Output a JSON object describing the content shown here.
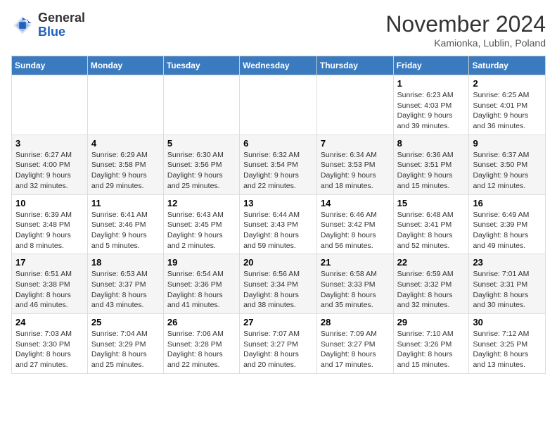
{
  "logo": {
    "general": "General",
    "blue": "Blue"
  },
  "header": {
    "month": "November 2024",
    "location": "Kamionka, Lublin, Poland"
  },
  "weekdays": [
    "Sunday",
    "Monday",
    "Tuesday",
    "Wednesday",
    "Thursday",
    "Friday",
    "Saturday"
  ],
  "weeks": [
    [
      {
        "day": "",
        "info": ""
      },
      {
        "day": "",
        "info": ""
      },
      {
        "day": "",
        "info": ""
      },
      {
        "day": "",
        "info": ""
      },
      {
        "day": "",
        "info": ""
      },
      {
        "day": "1",
        "info": "Sunrise: 6:23 AM\nSunset: 4:03 PM\nDaylight: 9 hours and 39 minutes."
      },
      {
        "day": "2",
        "info": "Sunrise: 6:25 AM\nSunset: 4:01 PM\nDaylight: 9 hours and 36 minutes."
      }
    ],
    [
      {
        "day": "3",
        "info": "Sunrise: 6:27 AM\nSunset: 4:00 PM\nDaylight: 9 hours and 32 minutes."
      },
      {
        "day": "4",
        "info": "Sunrise: 6:29 AM\nSunset: 3:58 PM\nDaylight: 9 hours and 29 minutes."
      },
      {
        "day": "5",
        "info": "Sunrise: 6:30 AM\nSunset: 3:56 PM\nDaylight: 9 hours and 25 minutes."
      },
      {
        "day": "6",
        "info": "Sunrise: 6:32 AM\nSunset: 3:54 PM\nDaylight: 9 hours and 22 minutes."
      },
      {
        "day": "7",
        "info": "Sunrise: 6:34 AM\nSunset: 3:53 PM\nDaylight: 9 hours and 18 minutes."
      },
      {
        "day": "8",
        "info": "Sunrise: 6:36 AM\nSunset: 3:51 PM\nDaylight: 9 hours and 15 minutes."
      },
      {
        "day": "9",
        "info": "Sunrise: 6:37 AM\nSunset: 3:50 PM\nDaylight: 9 hours and 12 minutes."
      }
    ],
    [
      {
        "day": "10",
        "info": "Sunrise: 6:39 AM\nSunset: 3:48 PM\nDaylight: 9 hours and 8 minutes."
      },
      {
        "day": "11",
        "info": "Sunrise: 6:41 AM\nSunset: 3:46 PM\nDaylight: 9 hours and 5 minutes."
      },
      {
        "day": "12",
        "info": "Sunrise: 6:43 AM\nSunset: 3:45 PM\nDaylight: 9 hours and 2 minutes."
      },
      {
        "day": "13",
        "info": "Sunrise: 6:44 AM\nSunset: 3:43 PM\nDaylight: 8 hours and 59 minutes."
      },
      {
        "day": "14",
        "info": "Sunrise: 6:46 AM\nSunset: 3:42 PM\nDaylight: 8 hours and 56 minutes."
      },
      {
        "day": "15",
        "info": "Sunrise: 6:48 AM\nSunset: 3:41 PM\nDaylight: 8 hours and 52 minutes."
      },
      {
        "day": "16",
        "info": "Sunrise: 6:49 AM\nSunset: 3:39 PM\nDaylight: 8 hours and 49 minutes."
      }
    ],
    [
      {
        "day": "17",
        "info": "Sunrise: 6:51 AM\nSunset: 3:38 PM\nDaylight: 8 hours and 46 minutes."
      },
      {
        "day": "18",
        "info": "Sunrise: 6:53 AM\nSunset: 3:37 PM\nDaylight: 8 hours and 43 minutes."
      },
      {
        "day": "19",
        "info": "Sunrise: 6:54 AM\nSunset: 3:36 PM\nDaylight: 8 hours and 41 minutes."
      },
      {
        "day": "20",
        "info": "Sunrise: 6:56 AM\nSunset: 3:34 PM\nDaylight: 8 hours and 38 minutes."
      },
      {
        "day": "21",
        "info": "Sunrise: 6:58 AM\nSunset: 3:33 PM\nDaylight: 8 hours and 35 minutes."
      },
      {
        "day": "22",
        "info": "Sunrise: 6:59 AM\nSunset: 3:32 PM\nDaylight: 8 hours and 32 minutes."
      },
      {
        "day": "23",
        "info": "Sunrise: 7:01 AM\nSunset: 3:31 PM\nDaylight: 8 hours and 30 minutes."
      }
    ],
    [
      {
        "day": "24",
        "info": "Sunrise: 7:03 AM\nSunset: 3:30 PM\nDaylight: 8 hours and 27 minutes."
      },
      {
        "day": "25",
        "info": "Sunrise: 7:04 AM\nSunset: 3:29 PM\nDaylight: 8 hours and 25 minutes."
      },
      {
        "day": "26",
        "info": "Sunrise: 7:06 AM\nSunset: 3:28 PM\nDaylight: 8 hours and 22 minutes."
      },
      {
        "day": "27",
        "info": "Sunrise: 7:07 AM\nSunset: 3:27 PM\nDaylight: 8 hours and 20 minutes."
      },
      {
        "day": "28",
        "info": "Sunrise: 7:09 AM\nSunset: 3:27 PM\nDaylight: 8 hours and 17 minutes."
      },
      {
        "day": "29",
        "info": "Sunrise: 7:10 AM\nSunset: 3:26 PM\nDaylight: 8 hours and 15 minutes."
      },
      {
        "day": "30",
        "info": "Sunrise: 7:12 AM\nSunset: 3:25 PM\nDaylight: 8 hours and 13 minutes."
      }
    ]
  ]
}
